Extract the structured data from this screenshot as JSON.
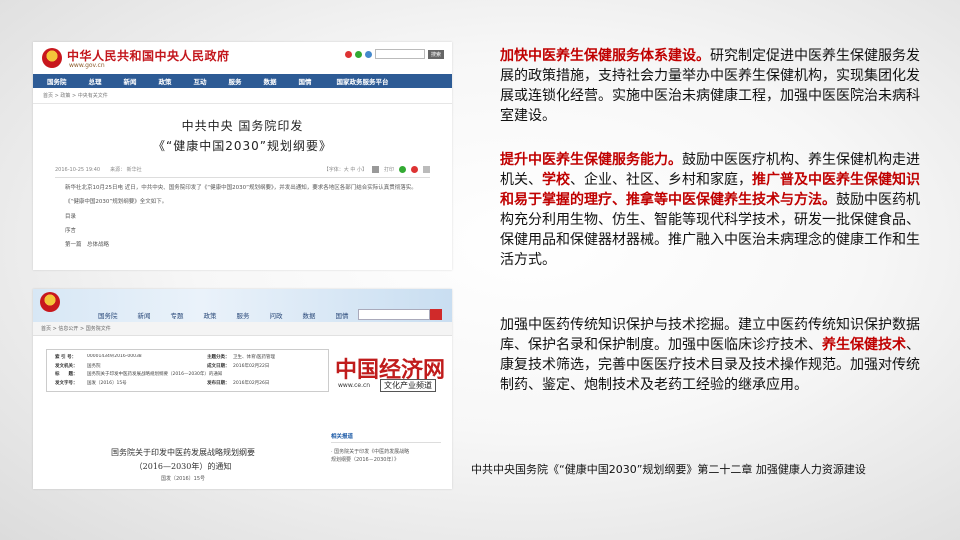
{
  "colors": {
    "accent_red": "#c00000",
    "gov_nav_blue": "#2d5b95",
    "gov_title_red": "#c3161c"
  },
  "screenshot1": {
    "site_title": "中华人民共和国中央人民政府",
    "site_url": "www.gov.cn",
    "search_button": "搜索",
    "nav_items": [
      "国务院",
      "总理",
      "新闻",
      "政策",
      "互动",
      "服务",
      "数据",
      "国情",
      "国家政务服务平台"
    ],
    "breadcrumb": "首页 > 政策 > 中央有关文件",
    "heading_1": "中共中央 国务院印发",
    "heading_2": "《“健康中国2030”规划纲要》",
    "meta_date": "2016-10-25 19:40",
    "meta_source": "来源： 新华社",
    "font_size_control": "【字体：大 中 小】",
    "print_label": "打印",
    "body_paragraph_1": "新华社北京10月25日电 近日，中共中央、国务院印发了《“健康中国2030”规划纲要》，并发出通知，要求各地区各部门结合实际认真贯彻落实。",
    "body_paragraph_2": "《“健康中国2030”规划纲要》全文如下。",
    "toc": [
      "目录",
      "序言",
      "第一篇　总体战略"
    ]
  },
  "screenshot2": {
    "nav_items": [
      "国务院",
      "新闻",
      "专题",
      "政策",
      "服务",
      "问政",
      "数据",
      "国情"
    ],
    "breadcrumb": "首页 > 信息公开 > 国务院文件",
    "table_rows": [
      {
        "k1": "索 引 号：",
        "v1": "000014349/2016-00038",
        "k2": "主题分类：",
        "v2": "卫生、体育\\医药管理"
      },
      {
        "k1": "发文机关：",
        "v1": "国务院",
        "k2": "成文日期：",
        "v2": "2016年02月22日"
      },
      {
        "k1": "标　　题：",
        "v1": "国务院关于印发中医药发展战略规划纲要（2016—2030年）的通知",
        "k2": "",
        "v2": ""
      },
      {
        "k1": "发文字号：",
        "v1": "国发〔2016〕15号",
        "k2": "发布日期：",
        "v2": "2016年02月26日"
      }
    ],
    "logo_text": "中国经济网",
    "logo_url": "www.ce.cn",
    "logo_sub": "文化产业频道",
    "doc_title_1": "国务院关于印发中医药发展战略规划纲要",
    "doc_title_2": "（2016—2030年）的通知",
    "doc_number": "国发〔2016〕15号",
    "related_heading": "相关报道",
    "related_items": [
      "· 国务院关于印发《中医药发展战略",
      "规划纲要（2016－2030年）》"
    ]
  },
  "paragraph_1": {
    "red_1": "加快中医养生保健服务体系建设。",
    "text_1": "研究制定促进中医养生保健服务发展的政策措施，支持社会力量举办中医养生保健机构，实现集团化发展或连锁化经营。实施中医治未病健康工程，加强中医医院治未病科室建设。"
  },
  "paragraph_2": {
    "red_1": "提升中医养生保健服务能力。",
    "text_1": "鼓励中医医疗机构、养生保健机构走进机关、",
    "red_2": "学校",
    "text_2": "、企业、社区、乡村和家庭，",
    "red_3": "推广普及中医养生保健知识和易于掌握的理疗、推拿等中医保健养生技术与方法。",
    "text_3": "鼓励中医药机构充分利用生物、仿生、智能等现代科学技术，研发一批保健食品、保健用品和保健器材器械。推广融入中医治未病理念的健康工作和生活方式。"
  },
  "paragraph_3": {
    "text_1": "加强中医药传统知识保护与技术挖掘。建立中医药传统知识保护数据库、保护名录和保护制度。加强中医临床诊疗技术、",
    "red_1": "养生保健技术",
    "text_2": "、康复技术筛选，完善中医医疗技术目录及技术操作规范。加强对传统制药、鉴定、炮制技术及老药工经验的继承应用。"
  },
  "caption": "中共中央国务院《“健康中国2030”规划纲要》第二十二章 加强健康人力资源建设"
}
